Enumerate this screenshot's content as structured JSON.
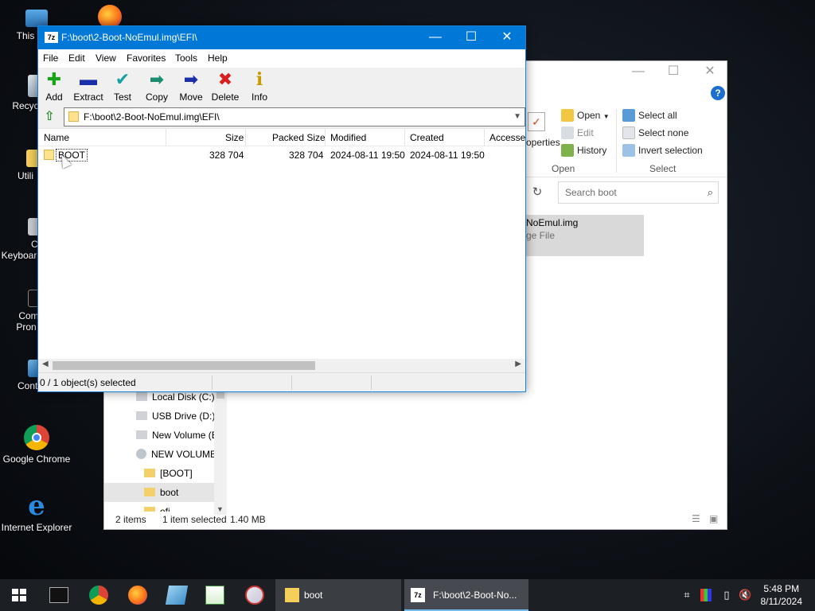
{
  "desktop": {
    "icons": [
      {
        "label": "This",
        "name": "this-pc"
      },
      {
        "label": "Recyc",
        "name": "recycle-bin"
      },
      {
        "label": "Utili",
        "name": "utilities"
      },
      {
        "label": "Cha",
        "label2": "Keyboar",
        "name": "change-keyboard"
      },
      {
        "label": "Comm",
        "label2": "Pron",
        "name": "command-prompt"
      },
      {
        "label": "Contro",
        "name": "control-panel"
      },
      {
        "label": "Google Chrome",
        "name": "google-chrome"
      },
      {
        "label": "Internet Explorer",
        "name": "internet-explorer"
      }
    ]
  },
  "explorer": {
    "ribbon": {
      "properties_label": "operties",
      "open_label": "Open",
      "edit_label": "Edit",
      "history_label": "History",
      "select_all": "Select all",
      "select_none": "Select none",
      "invert_selection": "Invert selection",
      "group_open": "Open",
      "group_select": "Select"
    },
    "search_placeholder": "Search boot",
    "selected_file": {
      "name": "NoEmul.img",
      "type": "ge File"
    },
    "nav": [
      {
        "label": "Local Disk (C:)",
        "icon": "drive-icon"
      },
      {
        "label": "USB Drive (D:)",
        "icon": "drive-icon"
      },
      {
        "label": "New Volume (E",
        "icon": "drive-icon"
      },
      {
        "label": "NEW VOLUME",
        "icon": "disc-icon"
      },
      {
        "label": "[BOOT]",
        "icon": "folder-icon"
      },
      {
        "label": "boot",
        "icon": "folder-icon"
      },
      {
        "label": "efi",
        "icon": "folder-icon"
      }
    ],
    "status": {
      "items": "2 items",
      "selected": "1 item selected",
      "size": "1.40 MB"
    }
  },
  "zip": {
    "title": "F:\\boot\\2-Boot-NoEmul.img\\EFI\\",
    "app_icon_text": "7z",
    "menu": [
      "File",
      "Edit",
      "View",
      "Favorites",
      "Tools",
      "Help"
    ],
    "tools": [
      {
        "label": "Add",
        "icon": "add-icon",
        "glyph": "✚",
        "color": "#1aa31a"
      },
      {
        "label": "Extract",
        "icon": "extract-icon",
        "glyph": "▬",
        "color": "#1b2fa8"
      },
      {
        "label": "Test",
        "icon": "test-icon",
        "glyph": "✔",
        "color": "#17a2a2"
      },
      {
        "label": "Copy",
        "icon": "copy-icon",
        "glyph": "➡",
        "color": "#1c8c6e"
      },
      {
        "label": "Move",
        "icon": "move-icon",
        "glyph": "➡",
        "color": "#1b2fa8"
      },
      {
        "label": "Delete",
        "icon": "delete-icon",
        "glyph": "✖",
        "color": "#d81e1e"
      },
      {
        "label": "Info",
        "icon": "info-icon",
        "glyph": "i",
        "color": "#c79a00"
      }
    ],
    "path": "F:\\boot\\2-Boot-NoEmul.img\\EFI\\",
    "columns": [
      "Name",
      "Size",
      "Packed Size",
      "Modified",
      "Created",
      "Accesse"
    ],
    "rows": [
      {
        "name": "BOOT",
        "size": "328 704",
        "packed": "328 704",
        "modified": "2024-08-11 19:50",
        "created": "2024-08-11 19:50"
      }
    ],
    "status": "0 / 1 object(s) selected"
  },
  "taskbar": {
    "tasks": [
      {
        "label": "boot",
        "name": "taskbar-explorer-boot"
      },
      {
        "label": "F:\\boot\\2-Boot-No...",
        "name": "taskbar-7zip"
      }
    ],
    "time": "5:48 PM",
    "date": "8/11/2024"
  }
}
